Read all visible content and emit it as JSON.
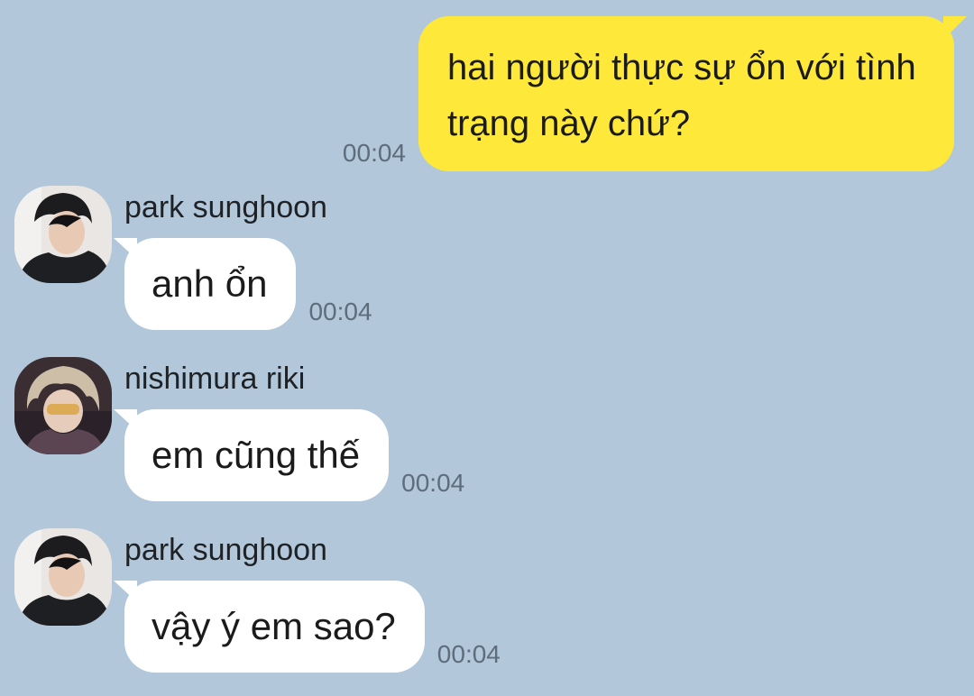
{
  "messages": [
    {
      "side": "out",
      "text": "hai người thực sự ổn với tình trạng này chứ?",
      "time": "00:04"
    },
    {
      "side": "in",
      "sender": "park sunghoon",
      "avatar_icon": "profile-photo-park-sunghoon",
      "text": "anh ổn",
      "time": "00:04"
    },
    {
      "side": "in",
      "sender": "nishimura riki",
      "avatar_icon": "profile-photo-nishimura-riki",
      "text": "em cũng thế",
      "time": "00:04"
    },
    {
      "side": "in",
      "sender": "park sunghoon",
      "avatar_icon": "profile-photo-park-sunghoon",
      "text": "vậy ý em sao?",
      "time": "00:04"
    }
  ],
  "colors": {
    "background": "#b2c7d9",
    "outgoing_bubble": "#fee93a",
    "incoming_bubble": "#ffffff",
    "timestamp": "#5d6d7c"
  }
}
